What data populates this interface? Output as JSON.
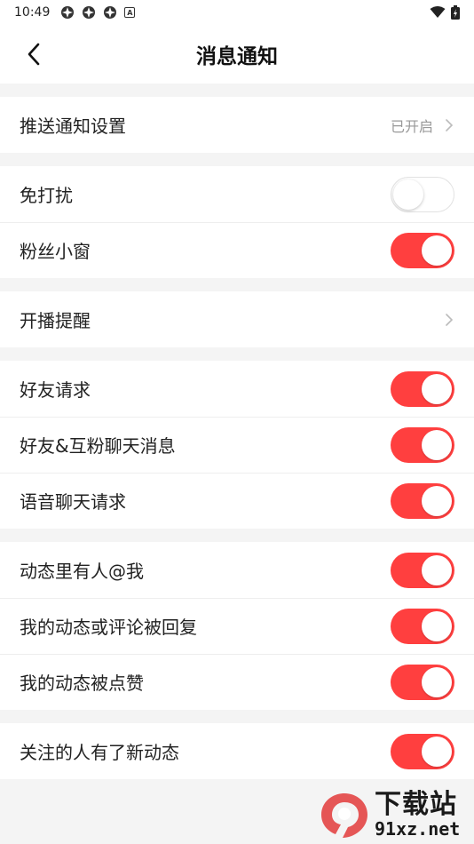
{
  "status_bar": {
    "time": "10:49",
    "badge": "A"
  },
  "header": {
    "title": "消息通知"
  },
  "groups": [
    [
      {
        "label": "推送通知设置",
        "value": "已开启"
      }
    ],
    [
      {
        "label": "免打扰",
        "on": false
      },
      {
        "label": "粉丝小窗",
        "on": true
      }
    ],
    [
      {
        "label": "开播提醒"
      }
    ],
    [
      {
        "label": "好友请求",
        "on": true
      },
      {
        "label": "好友&互粉聊天消息",
        "on": true
      },
      {
        "label": "语音聊天请求",
        "on": true
      }
    ],
    [
      {
        "label": "动态里有人@我",
        "on": true
      },
      {
        "label": "我的动态或评论被回复",
        "on": true
      },
      {
        "label": "我的动态被点赞",
        "on": true
      }
    ],
    [
      {
        "label": "关注的人有了新动态",
        "on": true
      }
    ]
  ],
  "colors": {
    "accent": "#ff3f3f",
    "background": "#f4f4f4"
  },
  "watermark": {
    "title": "下载站",
    "url": "91xz.net"
  }
}
